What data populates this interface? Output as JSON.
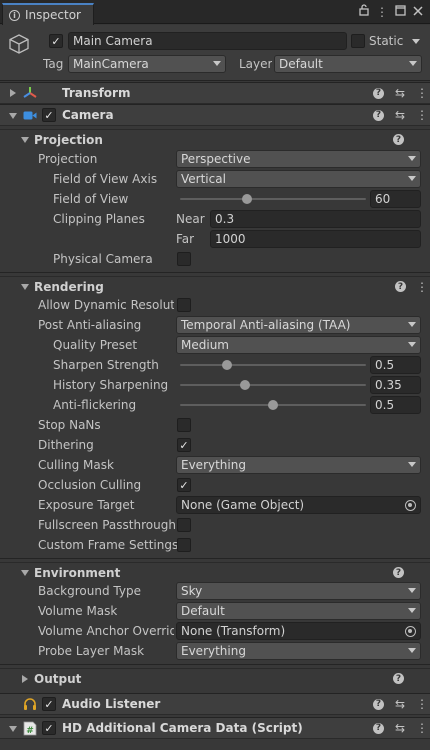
{
  "window": {
    "tab_label": "Inspector",
    "tab_tools": [
      "lock-icon",
      "kebab-icon",
      "maximize-icon",
      "close-icon"
    ]
  },
  "game_object": {
    "active": true,
    "name": "Main Camera",
    "static_label": "Static",
    "static_checked": false,
    "tag_label": "Tag",
    "tag_value": "MainCamera",
    "layer_label": "Layer",
    "layer_value": "Default"
  },
  "components": {
    "transform": {
      "title": "Transform",
      "expanded": false
    },
    "camera": {
      "title": "Camera",
      "enabled": true,
      "expanded": true
    },
    "audio_listener": {
      "title": "Audio Listener",
      "enabled": true,
      "expanded": false
    },
    "hd_camera_data": {
      "title": "HD Additional Camera Data (Script)",
      "enabled": true,
      "expanded": true
    }
  },
  "projection": {
    "section_title": "Projection",
    "projection_label": "Projection",
    "projection_value": "Perspective",
    "fov_axis_label": "Field of View Axis",
    "fov_axis_value": "Vertical",
    "fov_label": "Field of View",
    "fov_value": "60",
    "fov_fraction": 0.36,
    "clipping_label": "Clipping Planes",
    "near_label": "Near",
    "near_value": "0.3",
    "far_label": "Far",
    "far_value": "1000",
    "physical_label": "Physical Camera",
    "physical_checked": false
  },
  "rendering": {
    "section_title": "Rendering",
    "allow_dynres_label": "Allow Dynamic Resolution",
    "allow_dynres_checked": false,
    "post_aa_label": "Post Anti-aliasing",
    "post_aa_value": "Temporal Anti-aliasing (TAA)",
    "quality_label": "Quality Preset",
    "quality_value": "Medium",
    "sharpen_label": "Sharpen Strength",
    "sharpen_value": "0.5",
    "sharpen_fraction": 0.25,
    "history_label": "History Sharpening",
    "history_value": "0.35",
    "history_fraction": 0.35,
    "antiflicker_label": "Anti-flickering",
    "antiflicker_value": "0.5",
    "antiflicker_fraction": 0.5,
    "stop_nans_label": "Stop NaNs",
    "stop_nans_checked": false,
    "dithering_label": "Dithering",
    "dithering_checked": true,
    "culling_mask_label": "Culling Mask",
    "culling_mask_value": "Everything",
    "occlusion_label": "Occlusion Culling",
    "occlusion_checked": true,
    "exposure_label": "Exposure Target",
    "exposure_value": "None (Game Object)",
    "fullscreen_label": "Fullscreen Passthrough",
    "fullscreen_checked": false,
    "custom_frame_label": "Custom Frame Settings",
    "custom_frame_checked": false
  },
  "environment": {
    "section_title": "Environment",
    "bg_type_label": "Background Type",
    "bg_type_value": "Sky",
    "volume_mask_label": "Volume Mask",
    "volume_mask_value": "Default",
    "volume_anchor_label": "Volume Anchor Override",
    "volume_anchor_value": "None (Transform)",
    "probe_layer_label": "Probe Layer Mask",
    "probe_layer_value": "Everything"
  },
  "output": {
    "section_title": "Output",
    "expanded": false
  },
  "colors": {
    "background": "#383838",
    "field": "#2a2a2a",
    "dropdown": "#515151",
    "tab_accent": "#4a82c4",
    "camera_icon": "#3d8fe0",
    "audio_icon": "#e0a526",
    "script_icon": "#5ab05a"
  }
}
